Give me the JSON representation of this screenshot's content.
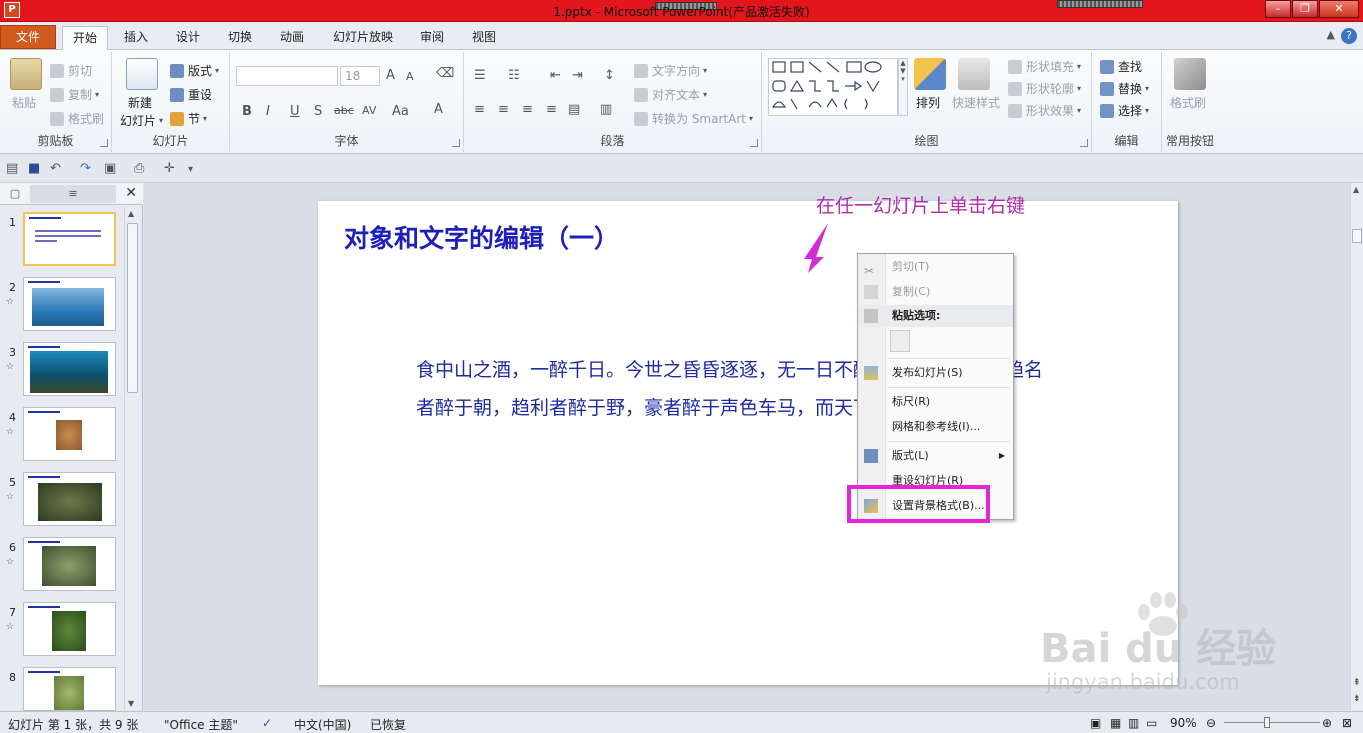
{
  "window": {
    "title": "1.pptx - Microsoft PowerPoint(产品激活失败)",
    "app_icon": "P"
  },
  "tabs": [
    "文件",
    "开始",
    "插入",
    "设计",
    "切换",
    "动画",
    "幻灯片放映",
    "审阅",
    "视图"
  ],
  "ribbon": {
    "clipboard": {
      "paste": "粘贴",
      "cut": "剪切",
      "copy": "复制",
      "format_painter": "格式刷",
      "label": "剪贴板"
    },
    "slides": {
      "new_slide_1": "新建",
      "new_slide_2": "幻灯片",
      "layout": "版式",
      "reset": "重设",
      "section": "节",
      "label": "幻灯片"
    },
    "font": {
      "size": "18",
      "label": "字体",
      "bold": "B",
      "italic": "I",
      "underline": "U",
      "shadow": "S",
      "strike": "abc",
      "spacing": "AV",
      "case": "Aa",
      "grow": "A",
      "shrink": "A",
      "color": "A"
    },
    "paragraph": {
      "text_direction": "文字方向",
      "align_text": "对齐文本",
      "smartart": "转换为 SmartArt",
      "label": "段落"
    },
    "drawing": {
      "arrange": "排列",
      "quick_styles": "快速样式",
      "shape_fill": "形状填充",
      "shape_outline": "形状轮廓",
      "shape_effects": "形状效果",
      "label": "绘图"
    },
    "editing": {
      "find": "查找",
      "replace": "替换",
      "select": "选择",
      "label": "编辑"
    },
    "common": {
      "format_painter": "格式刷",
      "label": "常用按钮"
    }
  },
  "slide_panel": {
    "tab_thumbs_icon": "▢",
    "tab_outline_icon": "≡",
    "close": "✕",
    "slides": [
      {
        "num": "1",
        "star": ""
      },
      {
        "num": "2",
        "star": "☆"
      },
      {
        "num": "3",
        "star": "☆"
      },
      {
        "num": "4",
        "star": "☆"
      },
      {
        "num": "5",
        "star": "☆"
      },
      {
        "num": "6",
        "star": "☆"
      },
      {
        "num": "7",
        "star": "☆"
      },
      {
        "num": "8",
        "star": ""
      }
    ]
  },
  "slide": {
    "title": "对象和文字的编辑（一）",
    "body": " 食中山之酒，一醉千日。今世之昏昏逐逐，无一日不醉，无一人不醉，趋名者醉于朝，趋利者醉于野，豪者醉于声色车马，而天下竟为昏迷不醒."
  },
  "annotation": "在任一幻灯片上单击右键",
  "context_menu": {
    "cut": "剪切(T)",
    "copy": "复制(C)",
    "paste_options": "粘贴选项:",
    "publish": "发布幻灯片(S)",
    "ruler": "标尺(R)",
    "grid": "网格和参考线(I)...",
    "layout": "版式(L)",
    "reset": "重设幻灯片(R)",
    "format_bg": "设置背景格式(B)..."
  },
  "status": {
    "slide_info": "幻灯片 第 1 张，共 9 张",
    "theme": "\"Office 主题\"",
    "language": "中文(中国)",
    "restored": "已恢复",
    "zoom": "90%"
  },
  "watermark": {
    "brand": "Bai du 经验",
    "url": "jingyan.baidu.com"
  },
  "colors": {
    "title_bar": "#e3151d",
    "file_tab": "#d35a1f",
    "slide_text": "#1e2aa0",
    "annotation": "#b02dae",
    "highlight_box": "#e626d6"
  }
}
